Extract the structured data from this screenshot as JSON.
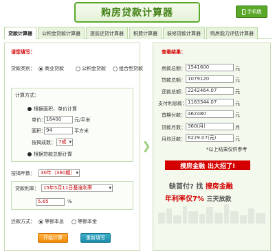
{
  "header": {
    "title": "购房贷款计算器",
    "mobile_label": "手机版"
  },
  "tabs": [
    {
      "label": "贷款计算器",
      "active": true
    },
    {
      "label": "公积金贷款计算器",
      "active": false
    },
    {
      "label": "提前还贷计算器",
      "active": false
    },
    {
      "label": "税费计算器",
      "active": false
    },
    {
      "label": "装修贷款计算器",
      "active": false
    },
    {
      "label": "购房能力评估计算器",
      "active": false
    }
  ],
  "form": {
    "heading": "请您填写：",
    "loan_type_label": "贷款类别：",
    "loan_type_options": [
      "商业贷款",
      "公积金贷款",
      "组合型贷款"
    ],
    "calc_method_label": "计算方式：",
    "method_by_area": "根据面积、单价计算",
    "unit_price_label": "单价：",
    "unit_price_value": "16400",
    "unit_price_unit": "元/平米",
    "area_label": "面积：",
    "area_value": "94",
    "area_unit": "平方米",
    "ratio_label": "按揭成数：",
    "ratio_value": "7成",
    "method_by_total": "根据贷款总额计算",
    "years_label": "按揭年数：",
    "years_value": "30年（360期）",
    "rate_label": "贷款利率：",
    "rate_value": "15年5月11日基准利率",
    "rate_input": "5.65",
    "rate_unit": "%",
    "repay_label": "还款方式：",
    "repay_options": [
      "等额本息",
      "等额本金"
    ],
    "start_button": "开始计算",
    "reset_button": "重新填写"
  },
  "results": {
    "heading": "查看结果：",
    "rows": [
      {
        "label": "房款总额：",
        "value": "1541600",
        "unit": "元"
      },
      {
        "label": "贷款总额：",
        "value": "1079120",
        "unit": "元"
      },
      {
        "label": "还款总额：",
        "value": "2242464.07",
        "unit": "元"
      },
      {
        "label": "支付利息款：",
        "value": "1163344.07",
        "unit": "元"
      },
      {
        "label": "首期付款：",
        "value": "462480",
        "unit": "元"
      },
      {
        "label": "贷款月数：",
        "value": "360(月)",
        "unit": "月"
      },
      {
        "label": "月均还款：",
        "value": "6229.07(元)",
        "unit": "元"
      }
    ],
    "note": "*以上结果仅供参考"
  },
  "ad": {
    "brand": "搜房金融",
    "slogan": "出大招了!",
    "line2_a": "缺首付?",
    "line2_b": "找",
    "line2_c": "搜房金融",
    "line3_a": "年利率仅7%",
    "line3_b": "三天放款"
  },
  "colors": {
    "brand_green": "#5aa82a",
    "accent_red": "#d40000",
    "start_orange": "#f08a00",
    "reset_teal": "#1a8aa8"
  }
}
